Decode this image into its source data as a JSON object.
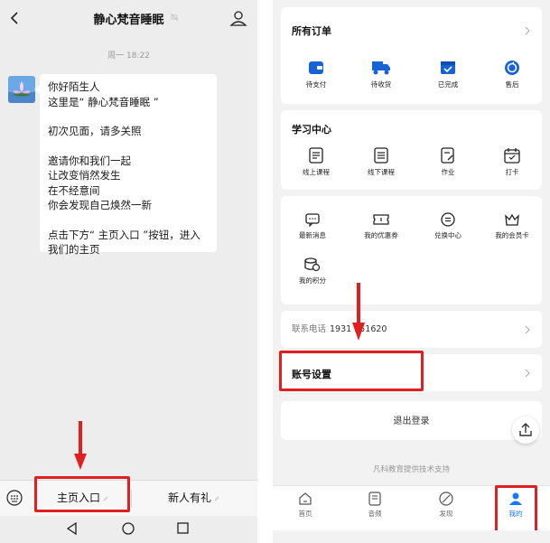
{
  "chat": {
    "title": "静心梵音睡眠",
    "time": "周一 18:22",
    "message": {
      "line1": "你好陌生人",
      "line2": "这里是“ 静心梵音睡眠 ”",
      "line3": "初次见面，请多关照",
      "line4": "邀请你和我们一起",
      "line5": "让改变悄然发生",
      "line6": "在不经意间",
      "line7": "你会发现自己焕然一新",
      "line8": "点击下方“ 主页入口 ”按钮，进入",
      "line9": "我们的主页"
    },
    "menu": {
      "left_label": "主页入口",
      "right_label": "新人有礼"
    }
  },
  "account": {
    "orders": {
      "title": "所有订单",
      "items": [
        {
          "label": "待支付",
          "icon": "wallet-icon"
        },
        {
          "label": "待收货",
          "icon": "truck-icon"
        },
        {
          "label": "已完成",
          "icon": "completed-box-icon"
        },
        {
          "label": "售后",
          "icon": "after-sales-icon"
        }
      ]
    },
    "learning": {
      "title": "学习中心",
      "items": [
        {
          "label": "线上课程",
          "icon": "online-course-icon"
        },
        {
          "label": "线下课程",
          "icon": "offline-course-icon"
        },
        {
          "label": "作业",
          "icon": "homework-icon"
        },
        {
          "label": "打卡",
          "icon": "calendar-checkin-icon"
        }
      ]
    },
    "services": {
      "items": [
        {
          "label": "最新消息",
          "icon": "message-icon"
        },
        {
          "label": "我的优惠券",
          "icon": "coupon-icon"
        },
        {
          "label": "兑换中心",
          "icon": "exchange-icon"
        },
        {
          "label": "我的会员卡",
          "icon": "vip-card-icon"
        },
        {
          "label": "我的积分",
          "icon": "points-icon"
        }
      ]
    },
    "phone": {
      "label": "联系电话",
      "value": "1931 251620"
    },
    "account_settings": "账号设置",
    "logout": "退出登录",
    "powered_by": "凡科教育提供技术支持",
    "tabs": [
      {
        "label": "首页",
        "icon": "home-icon"
      },
      {
        "label": "音频",
        "icon": "audio-icon"
      },
      {
        "label": "发现",
        "icon": "discover-icon"
      },
      {
        "label": "我的",
        "icon": "user-icon"
      }
    ]
  },
  "colors": {
    "accent_blue": "#1677ff",
    "highlight_red": "#e02020",
    "chat_bg": "#ededed",
    "page_bg": "#f2f2f2"
  }
}
